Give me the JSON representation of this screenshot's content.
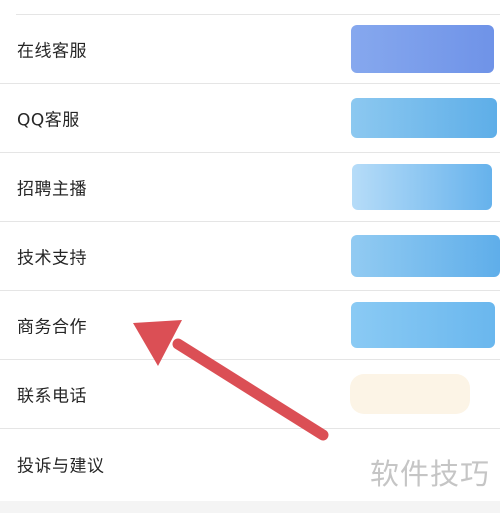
{
  "contacts_list": {
    "items": [
      {
        "label": "在线客服",
        "value_color": "#7da0ec"
      },
      {
        "label": "QQ客服",
        "value_color": "#6cb6ea"
      },
      {
        "label": "招聘主播",
        "value_color": "#74baf0"
      },
      {
        "label": "技术支持",
        "value_color": "#6db8ea"
      },
      {
        "label": "商务合作",
        "value_color": "#76bdee"
      },
      {
        "label": "联系电话",
        "value_color": "#fcf4e6"
      },
      {
        "label": "投诉与建议",
        "value_color": ""
      }
    ]
  },
  "annotation": {
    "arrow_color": "#db4f55"
  },
  "watermark": {
    "text": "软件技巧"
  }
}
